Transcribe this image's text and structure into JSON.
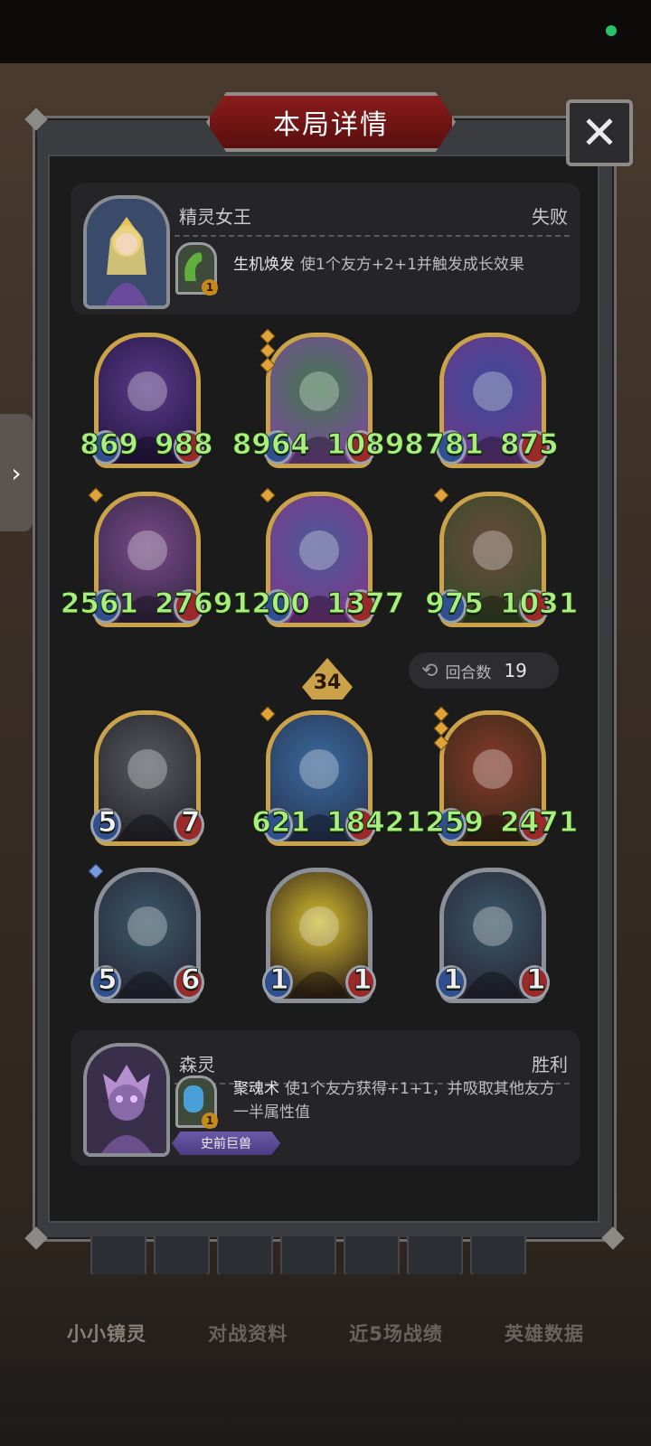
{
  "dialog": {
    "title": "本局详情",
    "close_label": "✕"
  },
  "player_top": {
    "hero_name": "精灵女王",
    "result": "失败",
    "skill_name": "生机焕发",
    "skill_desc": "使1个友方+2+1并触发成长效果",
    "skill_level": "1"
  },
  "upper_cards": [
    {
      "atk": "869",
      "hp": "988",
      "stars": 0
    },
    {
      "atk": "8964",
      "hp": "10898",
      "stars": 3
    },
    {
      "atk": "781",
      "hp": "875",
      "stars": 0
    },
    {
      "atk": "2561",
      "hp": "2769",
      "stars": 1
    },
    {
      "atk": "1200",
      "hp": "1377",
      "stars": 1
    },
    {
      "atk": "975",
      "hp": "1031",
      "stars": 1
    }
  ],
  "tier": "34",
  "round": {
    "label": "回合数",
    "value": "19"
  },
  "lower_cards": [
    {
      "atk": "5",
      "hp": "7",
      "stars": 0
    },
    {
      "atk": "621",
      "hp": "1842",
      "stars": 1
    },
    {
      "atk": "1259",
      "hp": "2471",
      "stars": 3
    },
    {
      "atk": "5",
      "hp": "6",
      "stars": 1
    },
    {
      "atk": "1",
      "hp": "1",
      "stars": 0
    },
    {
      "atk": "1",
      "hp": "1",
      "stars": 0
    }
  ],
  "player_bottom": {
    "hero_name": "森灵",
    "result": "胜利",
    "skill_name": "聚魂术",
    "skill_desc": "使1个友方获得+1+1，并吸取其他友方一半属性值",
    "skill_level": "1",
    "tribe": "史前巨兽"
  },
  "bottom_tabs": [
    "小小镜灵",
    "对战资料",
    "近5场战绩",
    "英雄数据"
  ],
  "colors": {
    "stat_green": "#a8ef7e",
    "gold_frame": "#c9a24a",
    "title_red": "#7a1616"
  }
}
